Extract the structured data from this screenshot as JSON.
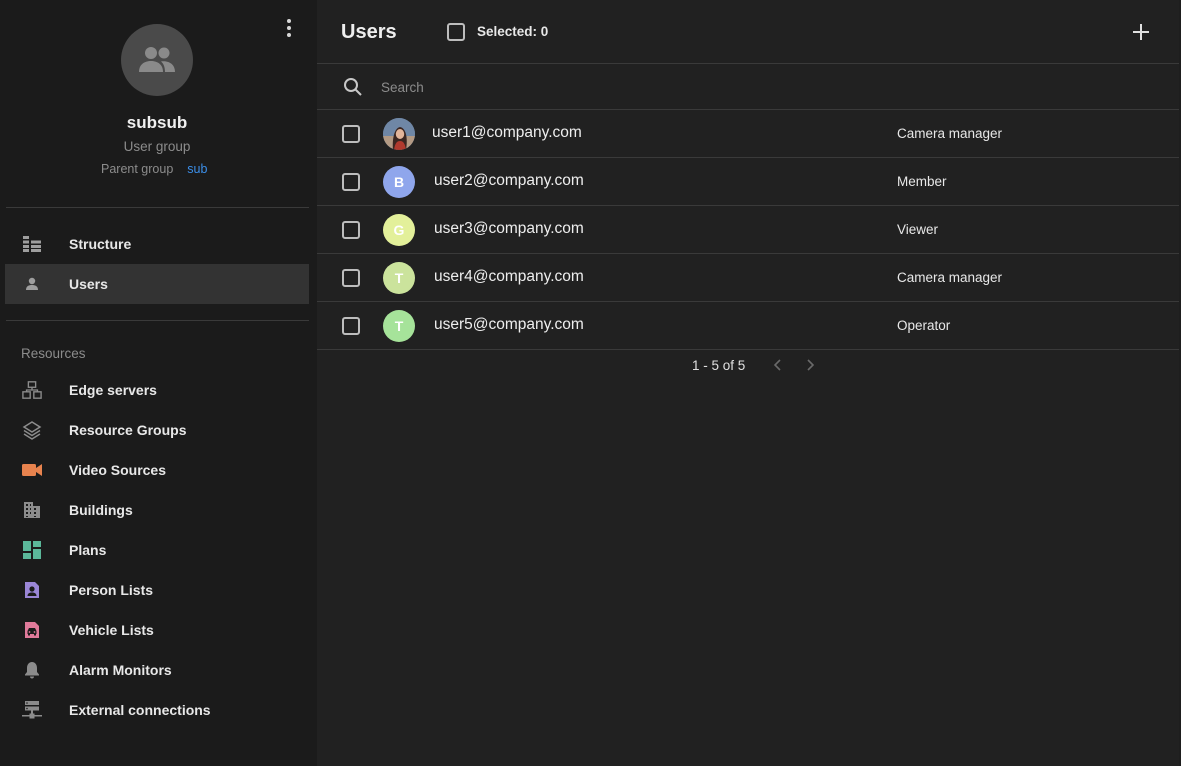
{
  "group": {
    "name": "subsub",
    "type": "User group",
    "parent_label": "Parent group",
    "parent_link": "sub"
  },
  "nav": {
    "items": [
      {
        "label": "Structure",
        "icon": "structure-icon",
        "active": false
      },
      {
        "label": "Users",
        "icon": "person-icon",
        "active": true
      }
    ]
  },
  "resources": {
    "title": "Resources",
    "items": [
      {
        "label": "Edge servers",
        "icon": "edge-servers-icon",
        "color": "#8c8c8c"
      },
      {
        "label": "Resource Groups",
        "icon": "layers-icon",
        "color": "#8c8c8c"
      },
      {
        "label": "Video Sources",
        "icon": "video-camera-icon",
        "color": "#e8834e"
      },
      {
        "label": "Buildings",
        "icon": "building-icon",
        "color": "#8c8c8c"
      },
      {
        "label": "Plans",
        "icon": "dashboard-icon",
        "color": "#5bb89a"
      },
      {
        "label": "Person Lists",
        "icon": "person-badge-icon",
        "color": "#9a86d6"
      },
      {
        "label": "Vehicle Lists",
        "icon": "vehicle-icon",
        "color": "#e07a9a"
      },
      {
        "label": "Alarm Monitors",
        "icon": "bell-icon",
        "color": "#8c8c8c"
      },
      {
        "label": "External connections",
        "icon": "network-icon",
        "color": "#8c8c8c"
      }
    ]
  },
  "header": {
    "title": "Users",
    "selected_label": "Selected: 0"
  },
  "search": {
    "placeholder": "Search",
    "value": ""
  },
  "users": [
    {
      "email": "user1@company.com",
      "role": "Camera manager",
      "initial": "",
      "avatar_color": "#5a6d86",
      "photo": true
    },
    {
      "email": "user2@company.com",
      "role": "Member",
      "initial": "B",
      "avatar_color": "#8fa6ec",
      "photo": false
    },
    {
      "email": "user3@company.com",
      "role": "Viewer",
      "initial": "G",
      "avatar_color": "#e3f09a",
      "photo": false
    },
    {
      "email": "user4@company.com",
      "role": "Camera manager",
      "initial": "T",
      "avatar_color": "#cbe39c",
      "photo": false
    },
    {
      "email": "user5@company.com",
      "role": "Operator",
      "initial": "T",
      "avatar_color": "#a6e39a",
      "photo": false
    }
  ],
  "pagination": {
    "range_label": "1 - 5 of 5"
  },
  "colors": {
    "link": "#3b8ee8",
    "sidebar_bg": "#1b1b1b",
    "main_bg": "#212121"
  }
}
